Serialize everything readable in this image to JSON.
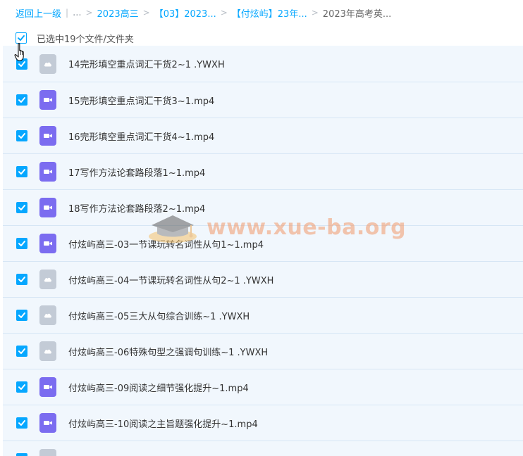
{
  "breadcrumb": {
    "back": "返回上一级",
    "ellipsis": "...",
    "items": [
      "2023高三",
      "【03】2023...",
      "【付炫屿】23年..."
    ],
    "current": "2023年高考英..."
  },
  "selection": {
    "label": "已选中19个文件/文件夹"
  },
  "files": [
    {
      "name": "14完形填空重点词汇干货2~1 .YWXH",
      "type": "generic"
    },
    {
      "name": "15完形填空重点词汇干货3~1.mp4",
      "type": "video"
    },
    {
      "name": "16完形填空重点词汇干货4~1.mp4",
      "type": "video"
    },
    {
      "name": "17写作方法论套路段落1~1.mp4",
      "type": "video"
    },
    {
      "name": "18写作方法论套路段落2~1.mp4",
      "type": "video"
    },
    {
      "name": "付炫屿高三-03一节课玩转名词性从句1~1.mp4",
      "type": "video"
    },
    {
      "name": "付炫屿高三-04一节课玩转名词性从句2~1 .YWXH",
      "type": "generic"
    },
    {
      "name": "付炫屿高三-05三大从句综合训练~1 .YWXH",
      "type": "generic"
    },
    {
      "name": "付炫屿高三-06特殊句型之强调句训练~1 .YWXH",
      "type": "generic"
    },
    {
      "name": "付炫屿高三-09阅读之细节强化提升~1.mp4",
      "type": "video"
    },
    {
      "name": "付炫屿高三-10阅读之主旨题强化提升~1.mp4",
      "type": "video"
    },
    {
      "name": "",
      "type": "generic"
    }
  ],
  "watermark": {
    "text": "www.xue-ba.org"
  },
  "colors": {
    "accent": "#06a7ff",
    "video_icon": "#7b6cf0",
    "generic_icon": "#c3cbd6",
    "row_bg": "#f1f7fd",
    "watermark": "#f2996b"
  }
}
